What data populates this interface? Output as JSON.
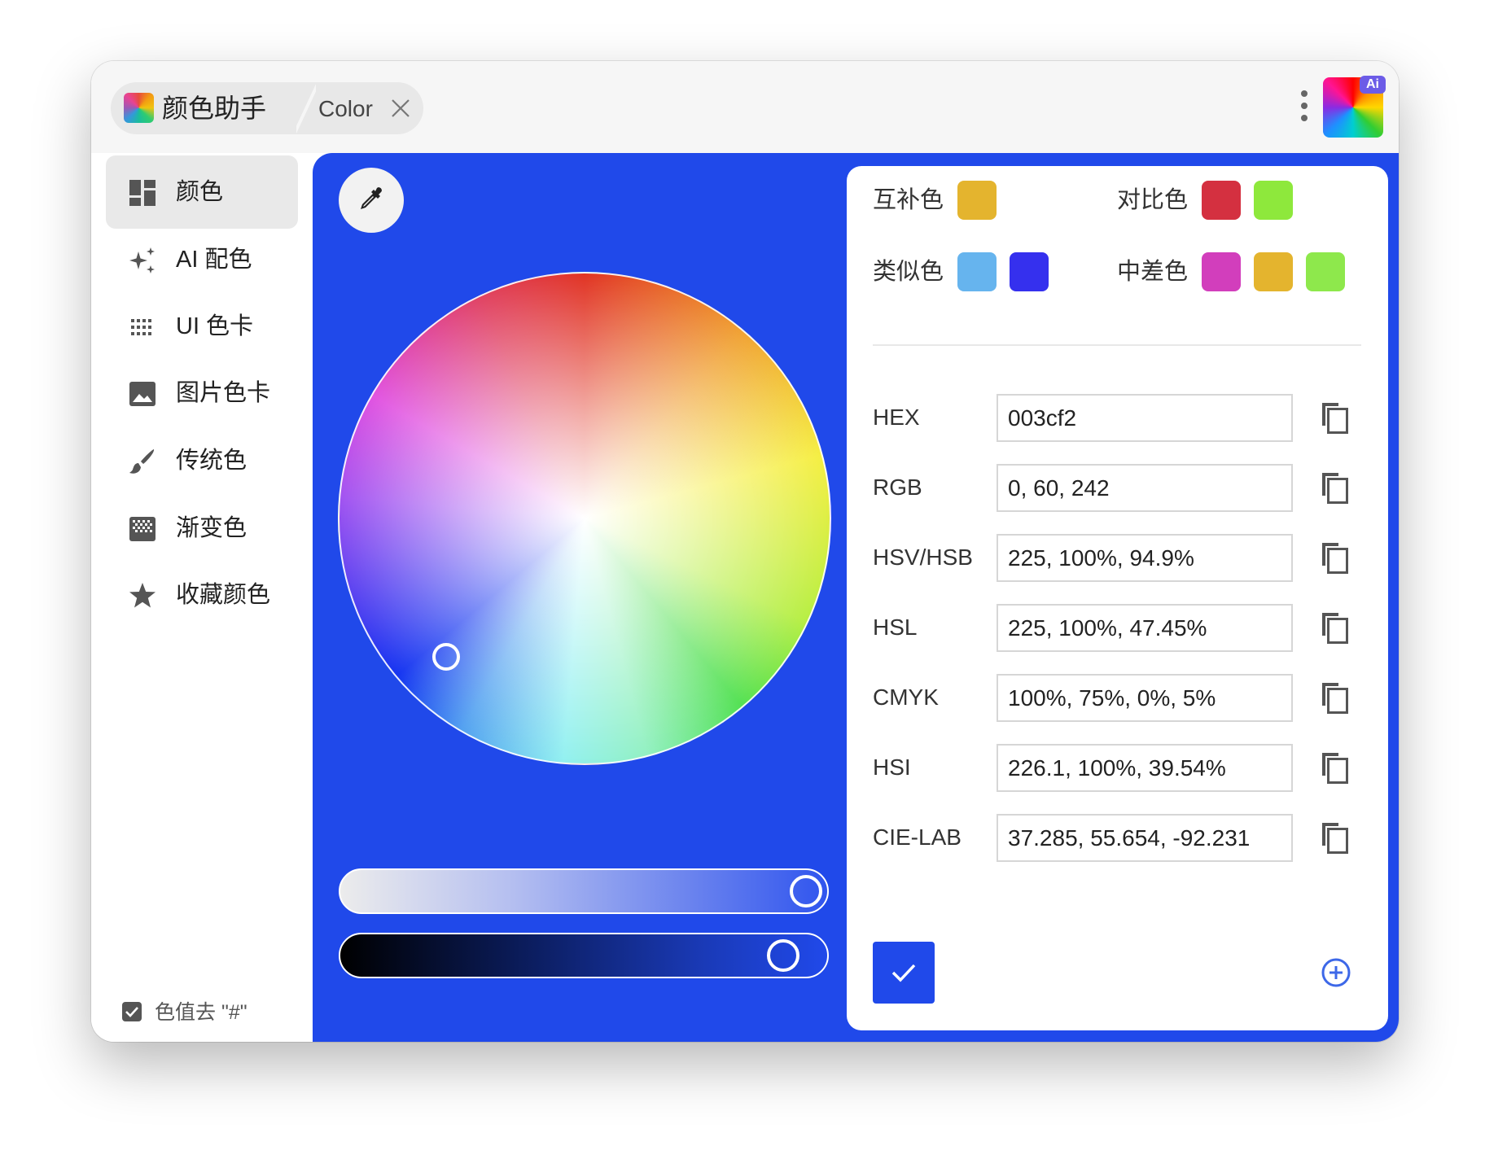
{
  "titlebar": {
    "app_name": "颜色助手",
    "tab_label": "Color",
    "ai_badge": "Ai"
  },
  "sidebar": {
    "items": [
      {
        "label": "颜色",
        "icon": "dashboard-icon",
        "active": true
      },
      {
        "label": "AI 配色",
        "icon": "sparkle-icon",
        "active": false
      },
      {
        "label": "UI 色卡",
        "icon": "grid-dots-icon",
        "active": false
      },
      {
        "label": "图片色卡",
        "icon": "image-icon",
        "active": false
      },
      {
        "label": "传统色",
        "icon": "brush-icon",
        "active": false
      },
      {
        "label": "渐变色",
        "icon": "gradient-icon",
        "active": false
      },
      {
        "label": "收藏颜色",
        "icon": "star-icon",
        "active": false
      }
    ],
    "strip_hash_label": "色值去 \"#\"",
    "strip_hash_checked": true
  },
  "picker": {
    "current_color": "#003cf2",
    "background": "#2049ea",
    "wheel_hue_deg": 225,
    "saturation_pct": 100,
    "brightness_pct": 94.9
  },
  "harmonies": {
    "complementary": {
      "label": "互补色",
      "colors": [
        "#e4b42e"
      ]
    },
    "contrast": {
      "label": "对比色",
      "colors": [
        "#d43040",
        "#8ee83c"
      ]
    },
    "analogous": {
      "label": "类似色",
      "colors": [
        "#66b4ee",
        "#3530ee"
      ]
    },
    "split": {
      "label": "中差色",
      "colors": [
        "#d23ebc",
        "#e4b42e",
        "#8ee84c"
      ]
    }
  },
  "formats": [
    {
      "label": "HEX",
      "value": "003cf2"
    },
    {
      "label": "RGB",
      "value": "0, 60, 242"
    },
    {
      "label": "HSV/HSB",
      "value": "225, 100%, 94.9%"
    },
    {
      "label": "HSL",
      "value": "225, 100%, 47.45%"
    },
    {
      "label": "CMYK",
      "value": "100%, 75%, 0%, 5%"
    },
    {
      "label": "HSI",
      "value": "226.1, 100%, 39.54%"
    },
    {
      "label": "CIE-LAB",
      "value": "37.285, 55.654, -92.231"
    }
  ],
  "colors": {
    "accent": "#2049ea",
    "add_icon": "#3d68e8"
  }
}
